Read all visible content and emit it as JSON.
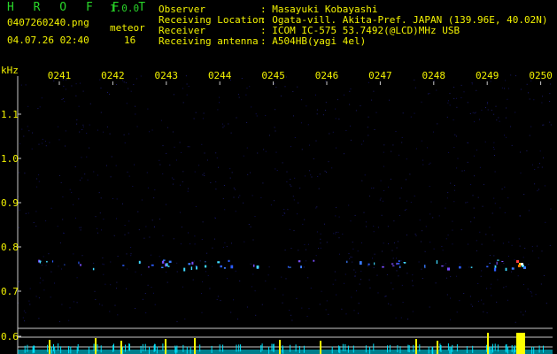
{
  "app": {
    "name": "H R O F F T",
    "version": "1.0.0"
  },
  "file": {
    "name": "0407260240.png",
    "datetime": "04.07.26 02:40"
  },
  "meteor": {
    "label": "meteor",
    "count": "16"
  },
  "info": {
    "observer_label": "Observer",
    "observer_value": ": Masayuki Kobayashi",
    "location_label": "Receiving Location",
    "location_value": ": Ogata-vill. Akita-Pref. JAPAN (139.96E, 40.02N)",
    "receiver_label": "Receiver",
    "receiver_value": ": ICOM IC-575 53.7492(@LCD)MHz USB",
    "antenna_label": "Receiving antenna",
    "antenna_value": ": A504HB(yagi 4el)"
  },
  "axis": {
    "unit": "kHz",
    "y_ticks": [
      "1.1",
      "1.0",
      "0.9",
      "0.8",
      "0.7",
      "0.6"
    ],
    "time_ticks": [
      "0241",
      "0242",
      "0243",
      "0244",
      "0245",
      "0246",
      "0247",
      "0248",
      "0249",
      "0250"
    ]
  },
  "colors": {
    "background": "#000000",
    "text": "#f2f200",
    "title": "#29d629",
    "noise": "#0c0c4a",
    "meteor_trace": "#3a7bff",
    "counter_bar": "#ffff00",
    "baseline": "#00e5ff"
  }
}
